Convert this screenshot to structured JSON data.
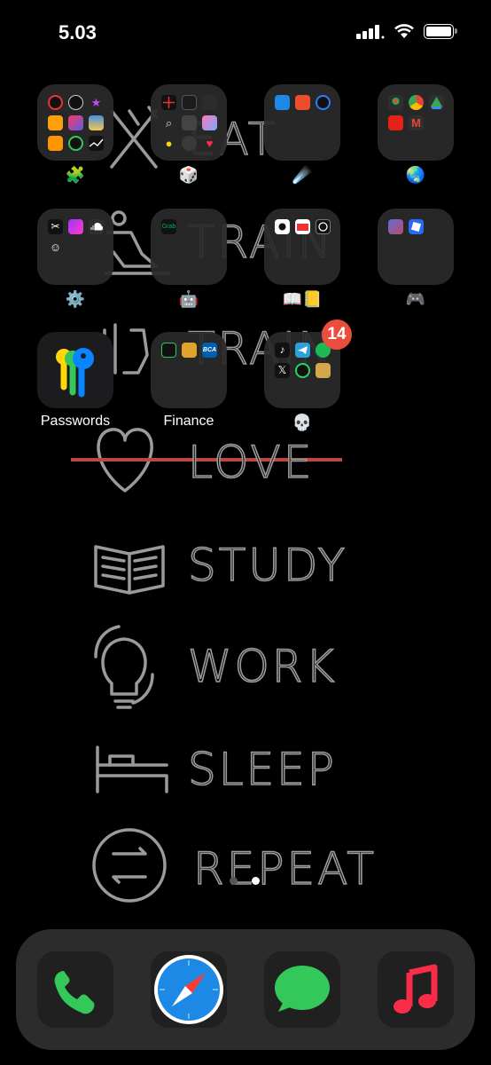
{
  "status_bar": {
    "time": "5.03",
    "icons": [
      "cellular-signal-icon",
      "wifi-icon",
      "battery-icon"
    ]
  },
  "wallpaper": {
    "words": [
      "EAT",
      "TRAIN",
      "TRAIN",
      "LOVE",
      "STUDY",
      "WORK",
      "SLEEP",
      "REPEAT"
    ],
    "icons": [
      "fork-knife-icon",
      "runner-icon",
      "dumbbell-icon",
      "heart-icon",
      "book-icon",
      "lightbulb-dollar-icon",
      "bed-icon",
      "cycle-arrows-icon"
    ],
    "line_color": "#9a9a9a",
    "strike_color": "#c0453f"
  },
  "folders": [
    {
      "label": "🧩",
      "apps": [
        "fitness-app",
        "clock-app",
        "itunes-store-app",
        "books-app",
        "shortcuts-app",
        "weather-app",
        "home-app",
        "find-my-app",
        "stocks-app"
      ]
    },
    {
      "label": "🎲",
      "apps": [
        "compass-app",
        "calculator-app",
        "voice-memos-app",
        "magnifier-app",
        "calculator-app-2",
        "butterfly-app",
        "tips-app",
        "contacts-app",
        "health-app"
      ]
    },
    {
      "label": "☄️",
      "apps": [
        "files-app",
        "shopee-app",
        "messenger-app"
      ]
    },
    {
      "label": "🌏",
      "apps": [
        "google-maps-app",
        "chrome-app",
        "google-drive-app",
        "youtube-app",
        "gmail-app"
      ]
    },
    {
      "label": "⚙️",
      "apps": [
        "capcut-app",
        "picsart-app",
        "soundcloud-app",
        "smile-app"
      ]
    },
    {
      "label": "🤖",
      "apps": [
        "grab-app"
      ]
    },
    {
      "label": "📖📒",
      "apps": [
        "grammar-app",
        "translate-app",
        "chatgpt-app"
      ]
    },
    {
      "label": "🎮",
      "apps": [
        "game-app",
        "roblox-app"
      ]
    },
    {
      "label": "Passwords",
      "apps": [
        "passwords-app"
      ]
    },
    {
      "label": "Finance",
      "apps": [
        "wallet-app",
        "jenius-app",
        "bca-mobile-app"
      ]
    },
    {
      "label": "💀",
      "apps": [
        "tiktok-app",
        "telegram-app",
        "spotify-app",
        "x-app",
        "whatsapp-app",
        "gold-app"
      ],
      "badge": "14"
    }
  ],
  "mini_icon_text": {
    "grab": "Grab",
    "bca": "BCA"
  },
  "page_dots": {
    "count": 2,
    "active": 2
  },
  "dock": [
    {
      "name": "Phone",
      "icon": "phone-icon",
      "color": "#34c759"
    },
    {
      "name": "Safari",
      "icon": "safari-compass-icon",
      "color": "#1e88e5"
    },
    {
      "name": "Messages",
      "icon": "messages-icon",
      "color": "#34c759"
    },
    {
      "name": "Music",
      "icon": "music-note-icon",
      "color": "#fa2d48"
    }
  ]
}
